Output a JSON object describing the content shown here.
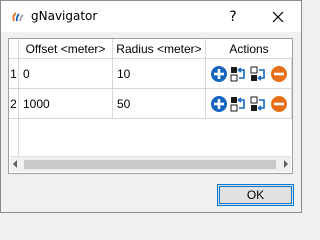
{
  "window": {
    "title": "gNavigator",
    "help_label": "?"
  },
  "table": {
    "columns": [
      "Offset <meter>",
      "Radius <meter>",
      "Actions"
    ],
    "rows": [
      {
        "index": "1",
        "offset": "0",
        "radius": "10"
      },
      {
        "index": "2",
        "offset": "1000",
        "radius": "50"
      }
    ]
  },
  "actions_icons": [
    "add-icon",
    "insert-before-icon",
    "insert-after-icon",
    "remove-icon"
  ],
  "colors": {
    "add": "#1565c0",
    "remove": "#e86f1a",
    "focus": "#0078d7"
  },
  "footer": {
    "ok_label": "OK"
  }
}
